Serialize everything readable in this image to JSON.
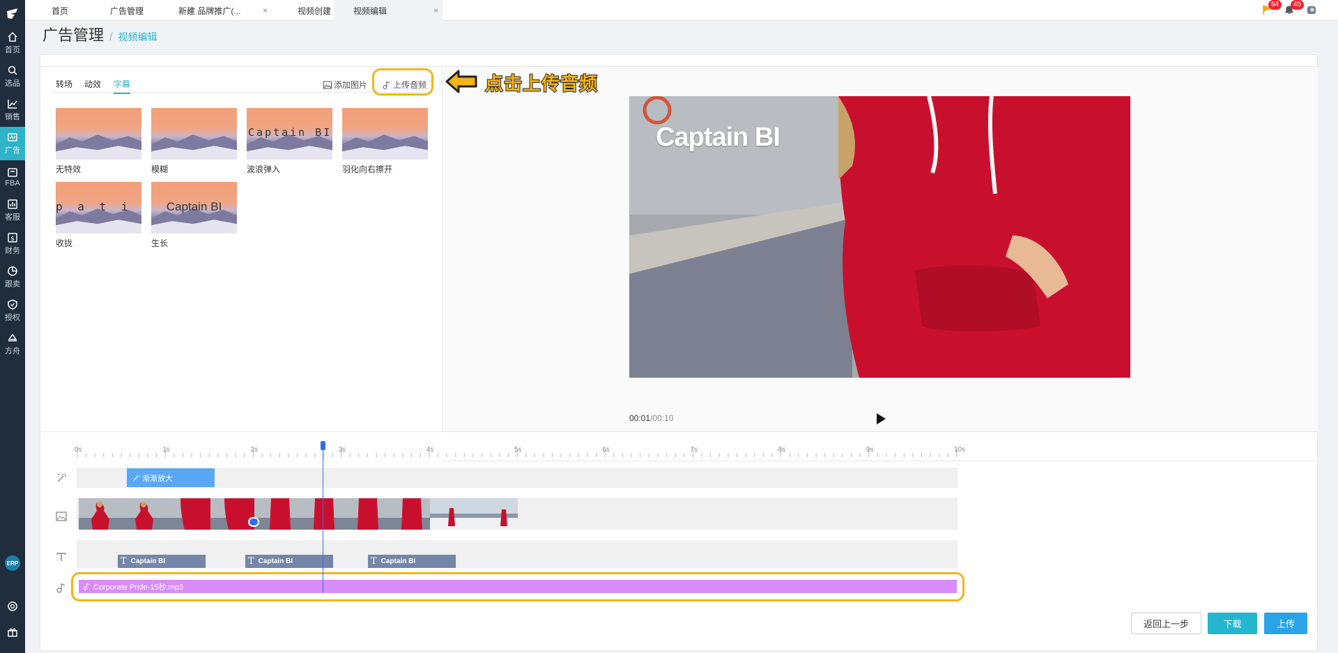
{
  "sidebar": {
    "items": [
      {
        "label": "首页",
        "icon": "home-icon"
      },
      {
        "label": "选品",
        "icon": "search-icon"
      },
      {
        "label": "销售",
        "icon": "chart-icon"
      },
      {
        "label": "广告",
        "icon": "ad-icon"
      },
      {
        "label": "FBA",
        "icon": "warehouse-icon"
      },
      {
        "label": "客服",
        "icon": "service-icon"
      },
      {
        "label": "财务",
        "icon": "finance-icon"
      },
      {
        "label": "跟卖",
        "icon": "pie-icon"
      },
      {
        "label": "授权",
        "icon": "shield-icon"
      },
      {
        "label": "方舟",
        "icon": "ark-icon"
      }
    ],
    "erp_label": "ERP"
  },
  "tabs": [
    {
      "label": "首页"
    },
    {
      "label": "广告管理"
    },
    {
      "label": "新建 品牌推广(..."
    },
    {
      "label": "视频创建"
    },
    {
      "label": "视频编辑"
    }
  ],
  "topright": {
    "flag_count": "84",
    "bell_count": "45"
  },
  "breadcrumb": {
    "title": "广告管理",
    "current": "视频编辑"
  },
  "panel": {
    "tabs": [
      "转场",
      "动效",
      "字幕"
    ],
    "active_tab": "字幕",
    "add_image": "添加图片",
    "upload_audio": "上传音频"
  },
  "effects": [
    {
      "label": "无特效",
      "text": ""
    },
    {
      "label": "模糊",
      "text": ""
    },
    {
      "label": "波浪弹入",
      "text": "Captain BI"
    },
    {
      "label": "羽化向右擦开",
      "text": ""
    },
    {
      "label": "收拢",
      "text": "p a t i n"
    },
    {
      "label": "生长",
      "text": "Captain BI"
    }
  ],
  "annotation": {
    "text": "点击上传音频"
  },
  "preview": {
    "caption": "Captain BI",
    "time_current": "00:01",
    "time_total": "/00:10"
  },
  "timeline": {
    "ticks": [
      "0s",
      "1s",
      "2s",
      "3s",
      "4s",
      "5s",
      "6s",
      "7s",
      "8s",
      "9s",
      "10s"
    ],
    "zoom_clip": "渐渐放大",
    "text_clips": [
      "Captain BI",
      "Captain BI",
      "Captain BI"
    ],
    "audio_clip": "Corporate Pride-15秒.mp3",
    "playhead_seconds": 2.8
  },
  "buttons": {
    "back": "返回上一步",
    "download": "下载",
    "upload": "上传"
  },
  "colors": {
    "accent": "#2eb3c7",
    "highlight": "#f5b418",
    "audio": "#d98cf7",
    "sidebar": "#1f2d3d"
  }
}
